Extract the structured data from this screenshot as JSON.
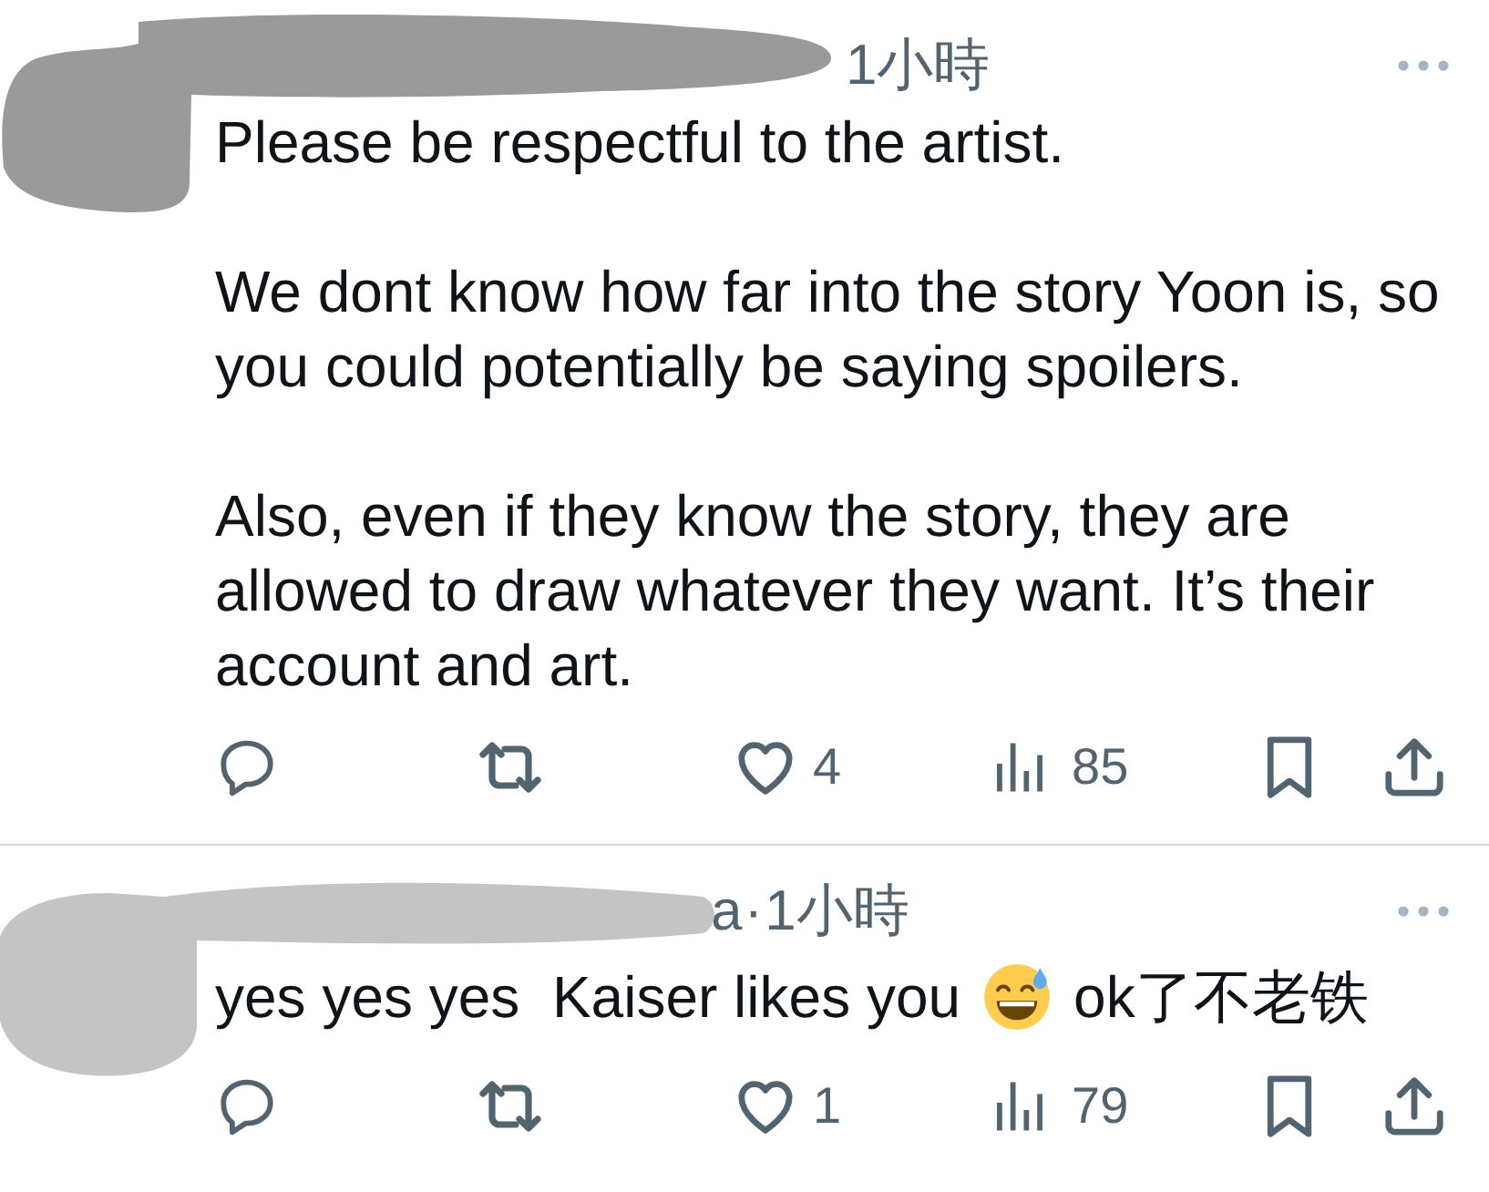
{
  "posts": [
    {
      "name_redacted": true,
      "header": {
        "time": "1小時"
      },
      "paragraphs": [
        {
          "segments": [
            {
              "kind": "text",
              "text": "Please be respectful to the artist."
            }
          ]
        },
        {
          "segments": [
            {
              "kind": "text",
              "text": "We dont know how far into the story Yoon is, so you could potentially be saying spoilers."
            }
          ]
        },
        {
          "segments": [
            {
              "kind": "text",
              "text": "Also, even if they know the story, they are allowed to draw whatever they want. It’s their account and art."
            }
          ]
        }
      ],
      "actions": [
        {
          "kind": "reply"
        },
        {
          "kind": "repost"
        },
        {
          "kind": "like",
          "count": "4"
        },
        {
          "kind": "views",
          "count": "85"
        },
        {
          "kind": "bookmark"
        },
        {
          "kind": "share"
        }
      ]
    },
    {
      "name_redacted": true,
      "header": {
        "name": "a",
        "separator": "·",
        "time": "1小時"
      },
      "paragraphs": [
        {
          "segments": [
            {
              "kind": "text",
              "text": "yes yes yes  Kaiser likes you"
            },
            {
              "kind": "emoji"
            },
            {
              "kind": "text",
              "text": "ok了不老铁"
            }
          ]
        }
      ],
      "actions": [
        {
          "kind": "reply"
        },
        {
          "kind": "repost"
        },
        {
          "kind": "like",
          "count": "1"
        },
        {
          "kind": "views",
          "count": "79"
        },
        {
          "kind": "bookmark"
        },
        {
          "kind": "share"
        }
      ]
    }
  ]
}
